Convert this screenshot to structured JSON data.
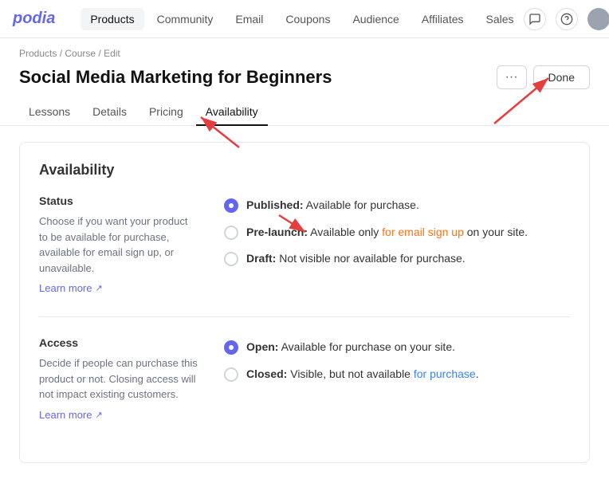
{
  "brand": "podia",
  "nav": {
    "links": [
      {
        "id": "products",
        "label": "Products",
        "active": true
      },
      {
        "id": "community",
        "label": "Community",
        "active": false
      },
      {
        "id": "email",
        "label": "Email",
        "active": false
      },
      {
        "id": "coupons",
        "label": "Coupons",
        "active": false
      },
      {
        "id": "audience",
        "label": "Audience",
        "active": false
      },
      {
        "id": "affiliates",
        "label": "Affiliates",
        "active": false
      },
      {
        "id": "sales",
        "label": "Sales",
        "active": false
      }
    ]
  },
  "breadcrumb": {
    "parts": [
      "Products",
      "Course",
      "Edit"
    ]
  },
  "page": {
    "title": "Social Media Marketing for Beginners",
    "btn_more": "···",
    "btn_done": "Done"
  },
  "tabs": [
    {
      "id": "lessons",
      "label": "Lessons",
      "active": false
    },
    {
      "id": "details",
      "label": "Details",
      "active": false
    },
    {
      "id": "pricing",
      "label": "Pricing",
      "active": false
    },
    {
      "id": "availability",
      "label": "Availability",
      "active": true
    }
  ],
  "card": {
    "title": "Availability",
    "status_section": {
      "title": "Status",
      "description": "Choose if you want your product to be available for purchase, available for email sign up, or unavailable.",
      "learn_more": "Learn more",
      "options": [
        {
          "id": "published",
          "selected": true,
          "label_bold": "Published:",
          "label_rest": " Available for purchase.",
          "highlight": ""
        },
        {
          "id": "prelaunch",
          "selected": false,
          "label_bold": "Pre-launch:",
          "label_rest": " Available only ",
          "label_orange": "for email sign up",
          "label_rest2": " on your site.",
          "highlight": "orange"
        },
        {
          "id": "draft",
          "selected": false,
          "label_bold": "Draft:",
          "label_rest": " Not visible nor available for purchase.",
          "highlight": ""
        }
      ]
    },
    "access_section": {
      "title": "Access",
      "description": "Decide if people can purchase this product or not. Closing access will not impact existing customers.",
      "learn_more": "Learn more",
      "options": [
        {
          "id": "open",
          "selected": true,
          "label_bold": "Open:",
          "label_rest": " Available for purchase on your site.",
          "highlight": ""
        },
        {
          "id": "closed",
          "selected": false,
          "label_bold": "Closed:",
          "label_rest": " Visible, but not available ",
          "label_blue": "for purchase",
          "label_rest2": ".",
          "highlight": "blue"
        }
      ]
    }
  }
}
